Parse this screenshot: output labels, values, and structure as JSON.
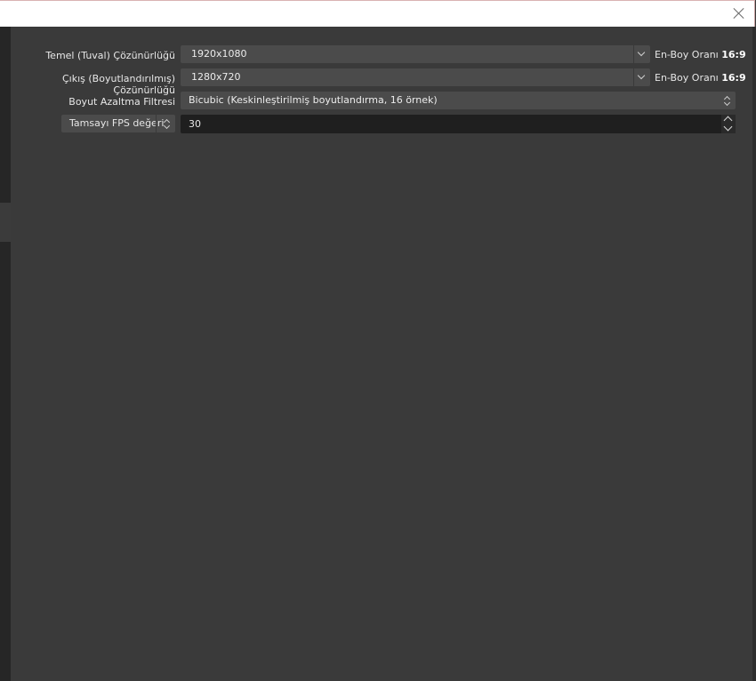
{
  "window": {
    "close_icon": "close-icon"
  },
  "video_settings": {
    "base_resolution": {
      "label": "Temel (Tuval) Çözünürlüğü",
      "value": "1920x1080",
      "ratio_label": "En-Boy Oranı",
      "ratio_value": "16:9"
    },
    "output_resolution": {
      "label": "Çıkış (Boyutlandırılmış) Çözünürlüğü",
      "value": "1280x720",
      "ratio_label": "En-Boy Oranı",
      "ratio_value": "16:9"
    },
    "downscale_filter": {
      "label": "Boyut Azaltma Filtresi",
      "value": "Bicubic (Keskinleştirilmiş boyutlandırma, 16 örnek)"
    },
    "fps": {
      "type_value": "Tamsayı FPS değeri",
      "value": "30"
    }
  },
  "colors": {
    "background": "#3a3a3a",
    "control": "#4b4b4b",
    "input": "#1f1f1f",
    "titlebar": "#ffffff"
  }
}
